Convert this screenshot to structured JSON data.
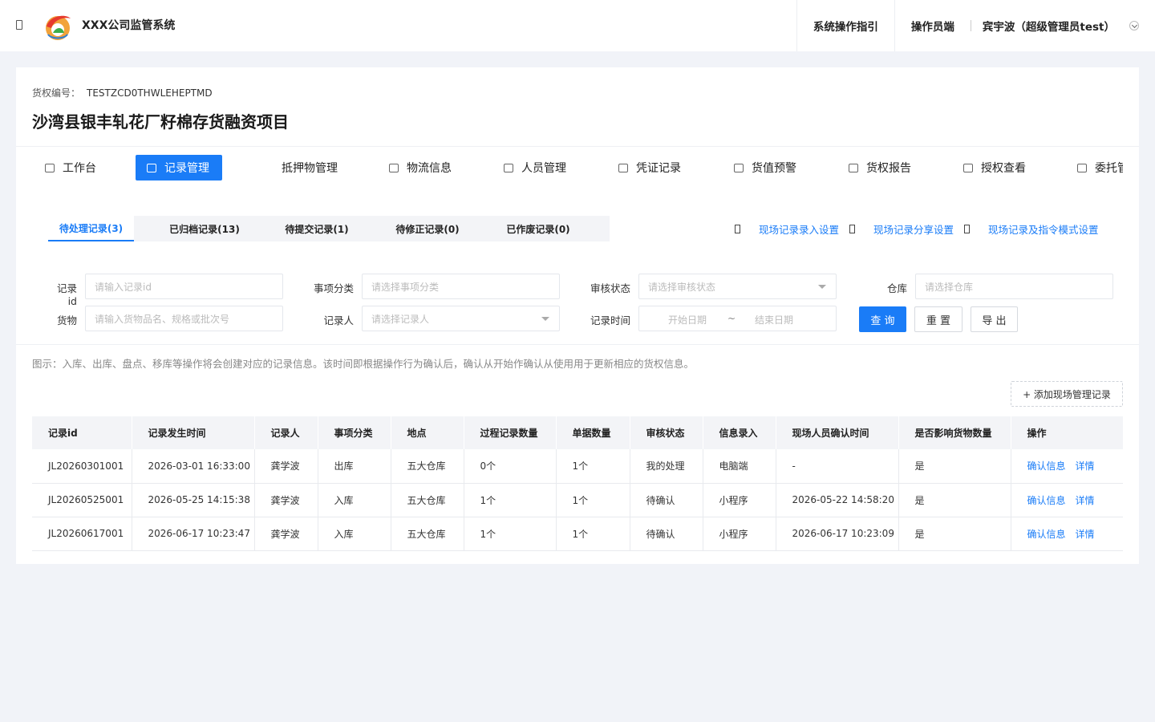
{
  "header": {
    "app_title": "XXX公司监管系统",
    "guide_link": "系统操作指引",
    "operator_link": "操作员端",
    "user_name": "宾宇波（超级管理员test）"
  },
  "project": {
    "rights_no_label": "货权编号：",
    "rights_no_value": "TESTZCD0THWLEHEPTMD",
    "title": "沙湾县银丰轧花厂籽棉存货融资项目"
  },
  "modules": [
    {
      "label": "工作台",
      "icon": "monitor-icon"
    },
    {
      "label": "记录管理",
      "icon": "record-icon",
      "active": true
    },
    {
      "label": "抵押物管理",
      "icon": ""
    },
    {
      "label": "物流信息",
      "icon": "truck-icon"
    },
    {
      "label": "人员管理",
      "icon": "people-icon"
    },
    {
      "label": "凭证记录",
      "icon": "voucher-icon"
    },
    {
      "label": "货值预警",
      "icon": "alarm-icon"
    },
    {
      "label": "货权报告",
      "icon": "report-icon"
    },
    {
      "label": "授权查看",
      "icon": "authorize-icon"
    },
    {
      "label": "委托管",
      "icon": "entrust-icon"
    }
  ],
  "subtabs": [
    "待处理记录(3)",
    "已归档记录(13)",
    "待提交记录(1)",
    "待修正记录(0)",
    "已作废记录(0)"
  ],
  "settings_links": [
    "现场记录录入设置",
    "现场记录分享设置",
    "现场记录及指令模式设置"
  ],
  "filters": {
    "record_id_label": "记录id",
    "record_id_placeholder": "请输入记录id",
    "category_label": "事项分类",
    "category_placeholder": "请选择事项分类",
    "audit_label": "审核状态",
    "audit_placeholder": "请选择审核状态",
    "warehouse_label": "仓库",
    "warehouse_placeholder": "请选择仓库",
    "goods_label": "货物",
    "goods_placeholder": "请输入货物品名、规格或批次号",
    "recorder_label": "记录人",
    "recorder_placeholder": "请选择记录人",
    "time_label": "记录时间",
    "start_placeholder": "开始日期",
    "range_sep": "~",
    "end_placeholder": "结束日期",
    "search_btn": "查 询",
    "reset_btn": "重 置",
    "export_btn": "导 出"
  },
  "hint": "图示：入库、出库、盘点、移库等操作将会创建对应的记录信息。该时间即根据操作行为确认后，确认从开始作确认从使用用于更新相应的货权信息。",
  "add_button": "+ 添加现场管理记录",
  "table": {
    "headers": [
      "记录id",
      "记录发生时间",
      "记录人",
      "事项分类",
      "地点",
      "过程记录数量",
      "单据数量",
      "审核状态",
      "信息录入",
      "现场人员确认时间",
      "是否影响货物数量",
      "操作"
    ],
    "rows": [
      [
        "JL20260301001",
        "2026-03-01 16:33:00",
        "龚学波",
        "出库",
        "五大仓库",
        "0个",
        "1个",
        "我的处理",
        "电脑端",
        "-",
        "是"
      ],
      [
        "JL20260525001",
        "2026-05-25 14:15:38",
        "龚学波",
        "入库",
        "五大仓库",
        "1个",
        "1个",
        "待确认",
        "小程序",
        "2026-05-22 14:58:20",
        "是"
      ],
      [
        "JL20260617001",
        "2026-06-17 10:23:47",
        "龚学波",
        "入库",
        "五大仓库",
        "1个",
        "1个",
        "待确认",
        "小程序",
        "2026-06-17 10:23:09",
        "是"
      ]
    ],
    "action_confirm": "确认信息",
    "action_detail": "详情"
  }
}
